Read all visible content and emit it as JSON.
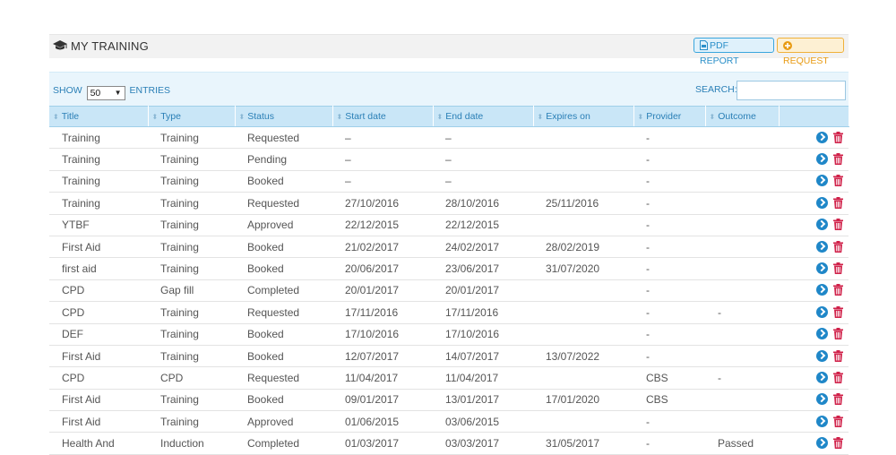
{
  "panel": {
    "title": "MY TRAINING",
    "title_icon": "graduation-cap-icon",
    "pdf_label": "PDF REPORT",
    "request_label": "REQUEST"
  },
  "toolbar": {
    "show_label": "SHOW",
    "entries_value": "50",
    "entries_label": "ENTRIES",
    "search_label": "SEARCH:",
    "search_value": ""
  },
  "columns": [
    "Title",
    "Type",
    "Status",
    "Start date",
    "End date",
    "Expires on",
    "Provider",
    "Outcome"
  ],
  "rows": [
    [
      "Training",
      "Training",
      "Requested",
      "–",
      "–",
      "",
      "-",
      ""
    ],
    [
      "Training",
      "Training",
      "Pending",
      "–",
      "–",
      "",
      "-",
      ""
    ],
    [
      "Training",
      "Training",
      "Booked",
      "–",
      "–",
      "",
      "-",
      ""
    ],
    [
      "Training",
      "Training",
      "Requested",
      "27/10/2016",
      "28/10/2016",
      "25/11/2016",
      "-",
      ""
    ],
    [
      "YTBF",
      "Training",
      "Approved",
      "22/12/2015",
      "22/12/2015",
      "",
      "-",
      ""
    ],
    [
      "First Aid",
      "Training",
      "Booked",
      "21/02/2017",
      "24/02/2017",
      "28/02/2019",
      "-",
      ""
    ],
    [
      "first aid",
      "Training",
      "Booked",
      "20/06/2017",
      "23/06/2017",
      "31/07/2020",
      "-",
      ""
    ],
    [
      "CPD",
      "Gap fill",
      "Completed",
      "20/01/2017",
      "20/01/2017",
      "",
      "-",
      ""
    ],
    [
      "CPD",
      "Training",
      "Requested",
      "17/11/2016",
      "17/11/2016",
      "",
      "-",
      "-"
    ],
    [
      "DEF",
      "Training",
      "Booked",
      "17/10/2016",
      "17/10/2016",
      "",
      "-",
      ""
    ],
    [
      "First Aid",
      "Training",
      "Booked",
      "12/07/2017",
      "14/07/2017",
      "13/07/2022",
      "-",
      ""
    ],
    [
      "CPD",
      "CPD",
      "Requested",
      "11/04/2017",
      "11/04/2017",
      "",
      "CBS",
      "-"
    ],
    [
      "First Aid",
      "Training",
      "Booked",
      "09/01/2017",
      "13/01/2017",
      "17/01/2020",
      "CBS",
      ""
    ],
    [
      "First Aid",
      "Training",
      "Approved",
      "01/06/2015",
      "03/06/2015",
      "",
      "-",
      ""
    ],
    [
      "Health And",
      "Induction",
      "Completed",
      "01/03/2017",
      "03/03/2017",
      "31/05/2017",
      "-",
      "Passed"
    ]
  ],
  "row_actions": {
    "view_icon": "arrow-circle-right-icon",
    "delete_icon": "trash-icon"
  },
  "colors": {
    "accent": "#2a7fb6",
    "header_bg": "#c9e6f7",
    "delete": "#d0224a",
    "request": "#f0b13a"
  }
}
